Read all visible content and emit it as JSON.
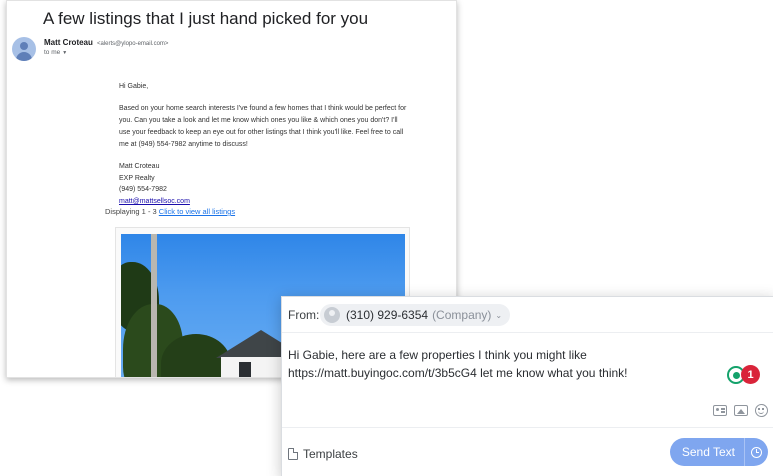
{
  "email": {
    "subject": "A few listings that I just hand picked for you",
    "sender_name": "Matt Croteau",
    "sender_email": "<alerts@ylopo-email.com>",
    "recipient": "to me",
    "greeting": "Hi Gabie,",
    "body": "Based on your home search interests I've found a few homes that I think would be perfect for you. Can you take a look and let me know which ones you like & which ones you don't? I'll use your feedback to keep an eye out for other listings that I think you'll like. Feel free to call me at (949) 554-7982 anytime to discuss!",
    "signature": {
      "name": "Matt Croteau",
      "company": "EXP Realty",
      "phone": "(949) 554-7982",
      "email": "matt@mattsellsoc.com"
    },
    "displaying_text": "Displaying 1 - 3",
    "view_all_link": "Click to view all listings"
  },
  "sms": {
    "from_label": "From:",
    "from_number": "(310) 929-6354",
    "from_tag": "(Company)",
    "message": "Hi Gabie, here are a few properties I think you might like https://matt.buyingoc.com/t/3b5cG4 let me know what you think!",
    "issue_count": "1",
    "templates_label": "Templates",
    "send_label": "Send Text"
  },
  "colors": {
    "accent": "#7fa6ef",
    "link": "#1a0dab",
    "badge": "#d9243a",
    "grammar": "#14a26b"
  },
  "icons": [
    "chevron-down-icon",
    "contact-card-icon",
    "image-icon",
    "emoji-icon",
    "document-icon",
    "clock-icon",
    "grammar-check-icon"
  ]
}
